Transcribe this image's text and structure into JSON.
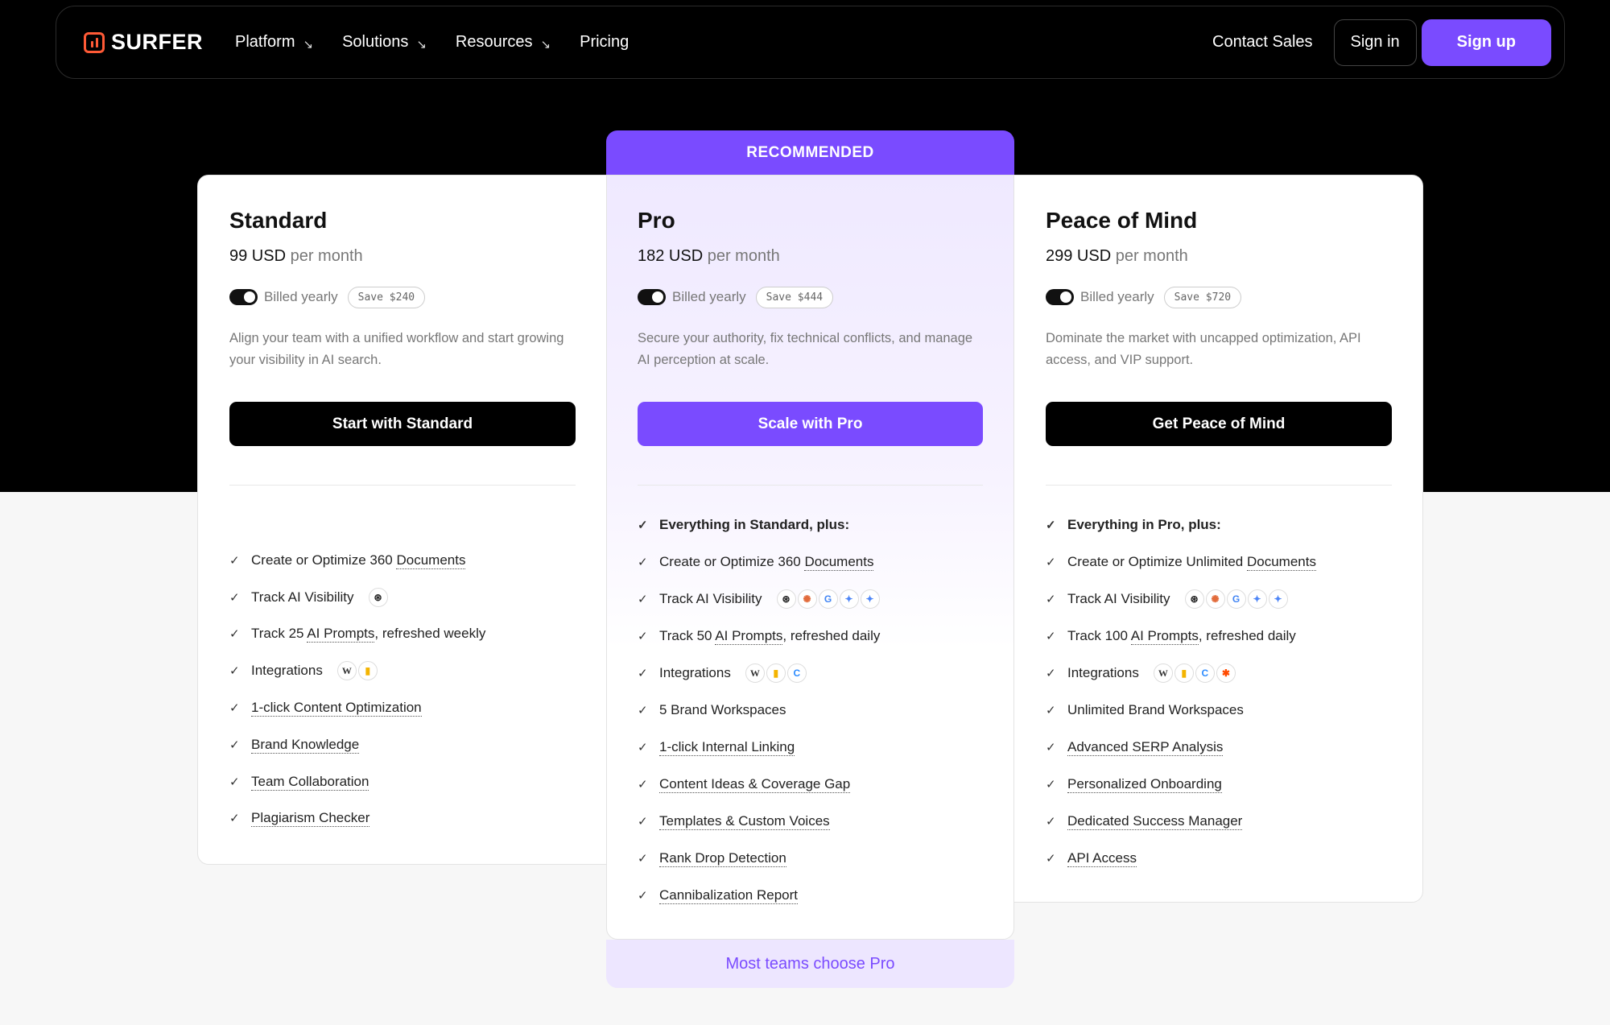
{
  "nav": {
    "logo": "SURFER",
    "menu": [
      {
        "label": "Platform",
        "has_arrow": true
      },
      {
        "label": "Solutions",
        "has_arrow": true
      },
      {
        "label": "Resources",
        "has_arrow": true
      },
      {
        "label": "Pricing",
        "has_arrow": false
      }
    ],
    "arrow_glyph": "↘",
    "contact": "Contact Sales",
    "signin": "Sign in",
    "signup": "Sign up"
  },
  "recommended_label": "RECOMMENDED",
  "pro_footer": "Most teams choose Pro",
  "check_glyph": "✓",
  "colors": {
    "accent": "#7a4bff",
    "dark": "#000000",
    "brand": "#ff5a36"
  },
  "plans": {
    "standard": {
      "name": "Standard",
      "price": "99 USD",
      "per": "per month",
      "billed": "Billed yearly",
      "save": "Save $240",
      "desc": "Align your team with a unified workflow and start growing your visibility in AI search.",
      "cta": "Start with Standard",
      "features": [
        {
          "parts": [
            "Create or Optimize 360 ",
            "Documents",
            ""
          ]
        },
        {
          "parts": [
            "Track AI Visibility",
            "",
            ""
          ],
          "icons": [
            "openai"
          ]
        },
        {
          "parts": [
            "Track 25 ",
            "AI Prompts",
            ", refreshed weekly"
          ]
        },
        {
          "parts": [
            "Integrations",
            "",
            ""
          ],
          "icons": [
            "wordpress",
            "google-docs"
          ]
        },
        {
          "parts": [
            "",
            "1-click Content Optimization",
            ""
          ]
        },
        {
          "parts": [
            "",
            "Brand Knowledge",
            ""
          ]
        },
        {
          "parts": [
            "",
            "Team Collaboration",
            ""
          ]
        },
        {
          "parts": [
            "",
            "Plagiarism Checker",
            ""
          ]
        }
      ]
    },
    "pro": {
      "name": "Pro",
      "price": "182 USD",
      "per": "per month",
      "billed": "Billed yearly",
      "save": "Save $444",
      "desc": "Secure your authority, fix technical conflicts, and manage AI perception at scale.",
      "cta": "Scale with Pro",
      "features": [
        {
          "parts": [
            "Everything in Standard, plus:",
            "",
            ""
          ],
          "bold": true
        },
        {
          "parts": [
            "Create or Optimize 360 ",
            "Documents",
            ""
          ]
        },
        {
          "parts": [
            "Track AI Visibility",
            "",
            ""
          ],
          "icons": [
            "openai",
            "claude",
            "google",
            "gemini",
            "gemini-sparkle"
          ]
        },
        {
          "parts": [
            "Track 50 ",
            "AI Prompts",
            ", refreshed daily"
          ]
        },
        {
          "parts": [
            "Integrations",
            "",
            ""
          ],
          "icons": [
            "wordpress",
            "google-docs",
            "contentful"
          ]
        },
        {
          "parts": [
            "5 Brand Workspaces",
            "",
            ""
          ]
        },
        {
          "parts": [
            "",
            "1-click Internal Linking",
            ""
          ]
        },
        {
          "parts": [
            "",
            "Content Ideas & Coverage Gap",
            ""
          ]
        },
        {
          "parts": [
            "",
            "Templates & Custom Voices",
            ""
          ]
        },
        {
          "parts": [
            "",
            "Rank Drop Detection",
            ""
          ]
        },
        {
          "parts": [
            "",
            "Cannibalization Report",
            ""
          ]
        }
      ]
    },
    "peace": {
      "name": "Peace of Mind",
      "price": "299 USD",
      "per": "per month",
      "billed": "Billed yearly",
      "save": "Save $720",
      "desc": "Dominate the market with uncapped optimization, API access, and VIP support.",
      "cta": "Get Peace of Mind",
      "features": [
        {
          "parts": [
            "Everything in Pro, plus:",
            "",
            ""
          ],
          "bold": true
        },
        {
          "parts": [
            "Create or Optimize Unlimited ",
            "Documents",
            ""
          ]
        },
        {
          "parts": [
            "Track AI Visibility",
            "",
            ""
          ],
          "icons": [
            "openai",
            "claude",
            "google",
            "gemini",
            "gemini-sparkle"
          ]
        },
        {
          "parts": [
            "Track 100 ",
            "AI Prompts",
            ", refreshed daily"
          ]
        },
        {
          "parts": [
            "Integrations",
            "",
            ""
          ],
          "icons": [
            "wordpress",
            "google-docs",
            "contentful",
            "zapier"
          ]
        },
        {
          "parts": [
            "Unlimited Brand Workspaces",
            "",
            ""
          ]
        },
        {
          "parts": [
            "",
            "Advanced SERP Analysis",
            ""
          ]
        },
        {
          "parts": [
            "",
            "Personalized Onboarding",
            ""
          ]
        },
        {
          "parts": [
            "",
            "Dedicated Success Manager",
            ""
          ]
        },
        {
          "parts": [
            "",
            "API Access",
            ""
          ]
        }
      ]
    }
  }
}
